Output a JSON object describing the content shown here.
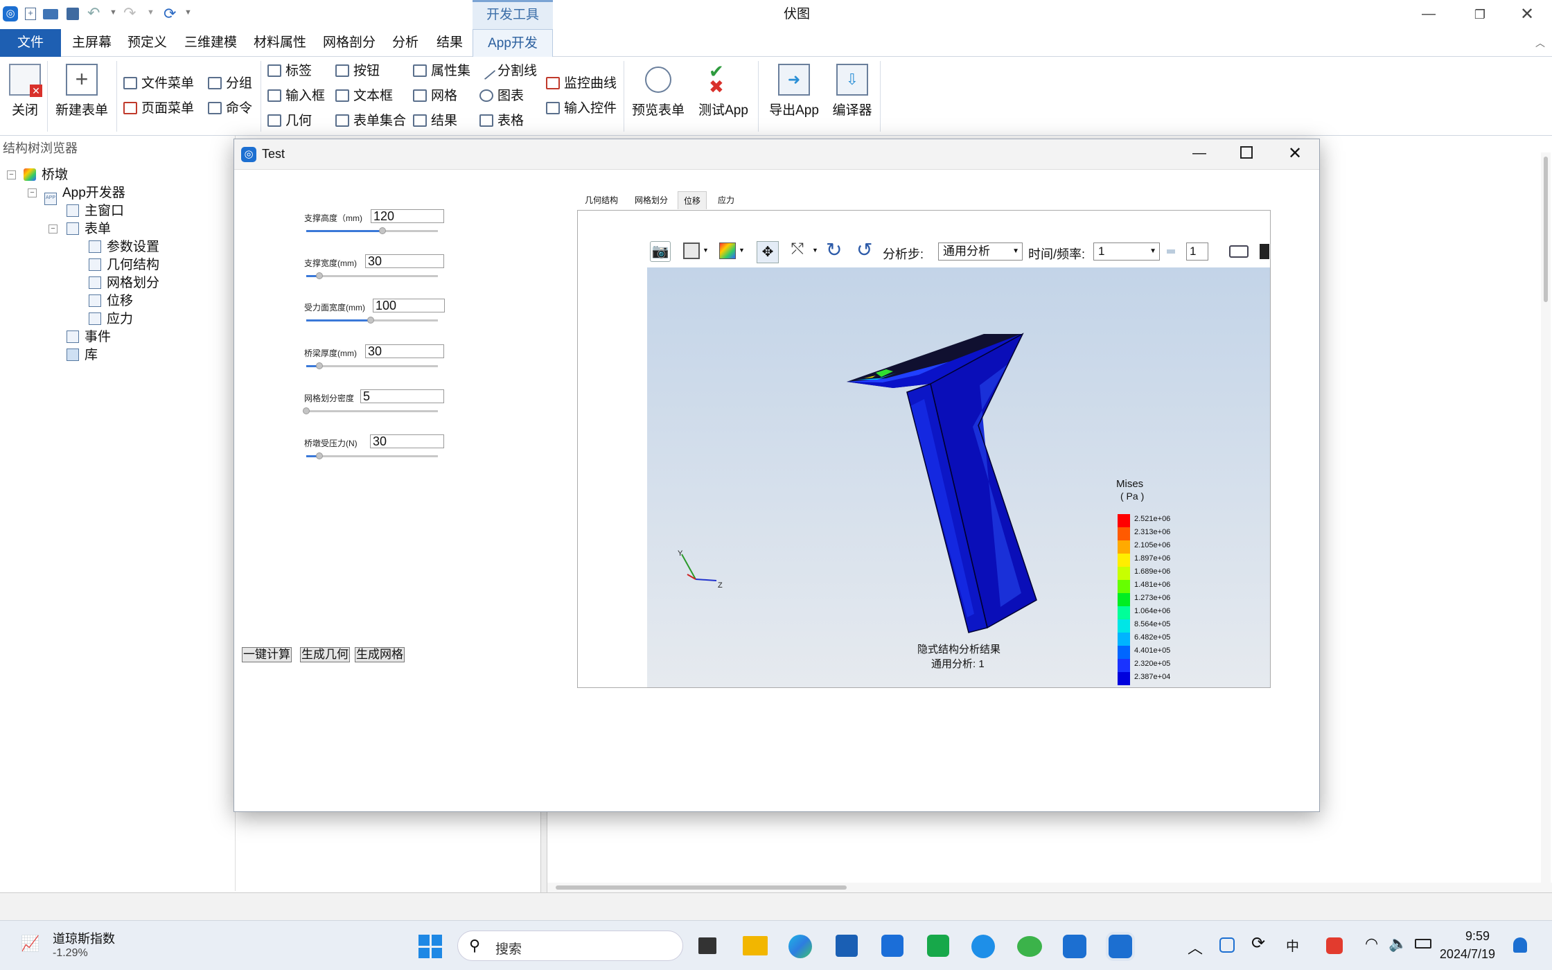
{
  "app": {
    "title": "伏图",
    "context_tab": "开发工具"
  },
  "menu_tabs": [
    "文件",
    "主屏幕",
    "预定义",
    "三维建模",
    "材料属性",
    "网格剖分",
    "分析",
    "结果",
    "App开发器"
  ],
  "ribbon": {
    "big": {
      "close": "关闭",
      "new_form": "新建表单",
      "preview": "预览表单",
      "test_app": "测试App",
      "export_app": "导出App",
      "compiler": "编译器"
    },
    "small": {
      "file_menu": "文件菜单",
      "page_menu": "页面菜单",
      "group": "分组",
      "command": "命令",
      "label": "标签",
      "input": "输入框",
      "geometry": "几何",
      "button": "按钮",
      "textbox": "文本框",
      "form_set": "表单集合",
      "property_set": "属性集",
      "mesh": "网格",
      "result": "结果",
      "separator": "分割线",
      "chart": "图表",
      "table": "表格",
      "monitor_curve": "监控曲线",
      "input_control": "输入控件"
    }
  },
  "tree": {
    "panel_title": "结构树浏览器",
    "root": "桥墩",
    "app_dev": "App开发器",
    "main_window": "主窗口",
    "forms": "表单",
    "form_items": [
      "参数设置",
      "几何结构",
      "网格划分",
      "位移",
      "应力"
    ],
    "events": "事件",
    "library": "库"
  },
  "dialog": {
    "title": "Test",
    "params": [
      {
        "label": "支撑高度（mm)",
        "value": "120",
        "level": 0.58
      },
      {
        "label": "支撑宽度(mm)",
        "value": "30",
        "level": 0.1
      },
      {
        "label": "受力面宽度(mm)",
        "value": "100",
        "level": 0.49
      },
      {
        "label": "桥梁厚度(mm)",
        "value": "30",
        "level": 0.1
      },
      {
        "label": "网格划分密度",
        "value": "5",
        "level": 0.0
      },
      {
        "label": "桥墩受压力(N)",
        "value": "30",
        "level": 0.1
      }
    ],
    "buttons": {
      "compute": "一键计算",
      "gen_geom": "生成几何",
      "gen_mesh": "生成网格"
    },
    "view_tabs": [
      "几何结构",
      "网格划分",
      "位移",
      "应力"
    ],
    "viewer": {
      "step_label": "分析步:",
      "step_value": "通用分析",
      "time_label": "时间/频率:",
      "time_value": "1",
      "frame_value": "1",
      "caption1": "隐式结构分析结果",
      "caption2": "通用分析: 1",
      "legend_title": "Mises",
      "legend_unit": "( Pa )",
      "legend_values": [
        "2.521e+06",
        "2.313e+06",
        "2.105e+06",
        "1.897e+06",
        "1.689e+06",
        "1.481e+06",
        "1.273e+06",
        "1.064e+06",
        "8.564e+05",
        "6.482e+05",
        "4.401e+05",
        "2.320e+05",
        "2.387e+04"
      ],
      "legend_colors": [
        "#ff0000",
        "#ff5a00",
        "#ffaa00",
        "#ffee00",
        "#c8ff00",
        "#66ff00",
        "#00ee22",
        "#00ff99",
        "#00e6e6",
        "#00b4ff",
        "#0066ff",
        "#1a33ff",
        "#0000dd"
      ],
      "axis_labels": {
        "y": "Y",
        "z": "Z"
      }
    }
  },
  "taskbar": {
    "stock_name": "道琼斯指数",
    "stock_change": "-1.29%",
    "search": "搜索",
    "ime": "中",
    "time": "9:59",
    "date": "2024/7/19"
  }
}
